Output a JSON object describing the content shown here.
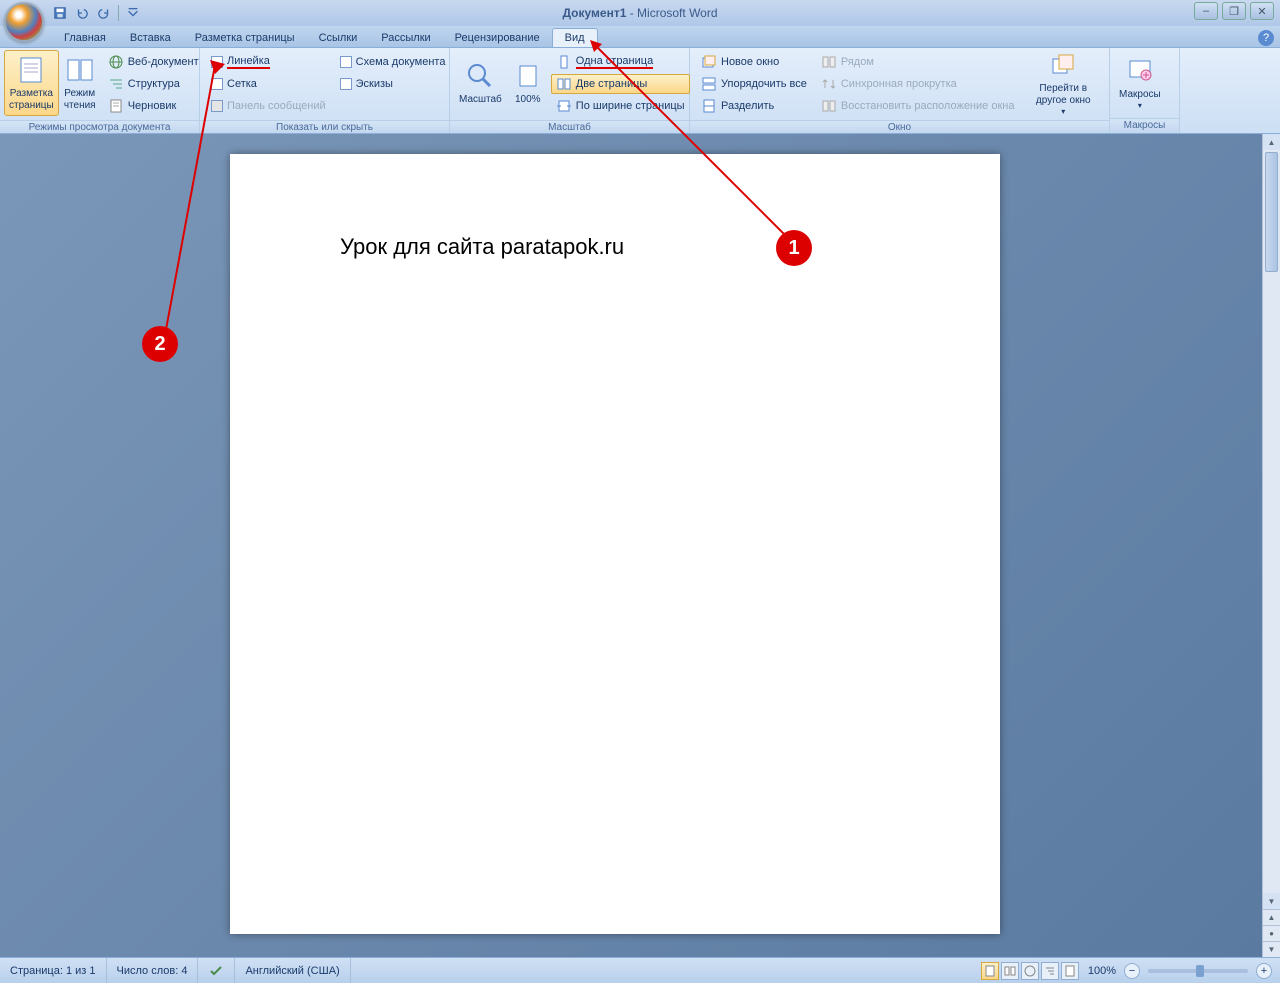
{
  "title": {
    "document": "Документ1",
    "app": "Microsoft Word"
  },
  "tabs": {
    "home": "Главная",
    "insert": "Вставка",
    "pagelayout": "Разметка страницы",
    "references": "Ссылки",
    "mailings": "Рассылки",
    "review": "Рецензирование",
    "view": "Вид"
  },
  "ribbon": {
    "views_group": "Режимы просмотра документа",
    "print_layout": "Разметка страницы",
    "reading": "Режим чтения",
    "web": "Веб-документ",
    "outline": "Структура",
    "draft": "Черновик",
    "show_group": "Показать или скрыть",
    "ruler": "Линейка",
    "gridlines": "Сетка",
    "message_bar": "Панель сообщений",
    "doc_map": "Схема документа",
    "thumbnails": "Эскизы",
    "zoom_group": "Масштаб",
    "zoom": "Масштаб",
    "hundred": "100%",
    "one_page": "Одна страница",
    "two_pages": "Две страницы",
    "page_width": "По ширине страницы",
    "window_group": "Окно",
    "new_window": "Новое окно",
    "arrange_all": "Упорядочить все",
    "split": "Разделить",
    "side_by_side": "Рядом",
    "sync_scroll": "Синхронная прокрутка",
    "reset_pos": "Восстановить расположение окна",
    "switch": "Перейти в другое окно",
    "macros_group": "Макросы",
    "macros": "Макросы"
  },
  "document": {
    "text": "Урок для сайта paratapok.ru"
  },
  "annotations": {
    "marker1": "1",
    "marker2": "2"
  },
  "status": {
    "page": "Страница: 1 из 1",
    "words": "Число слов: 4",
    "lang": "Английский (США)",
    "zoom": "100%"
  }
}
